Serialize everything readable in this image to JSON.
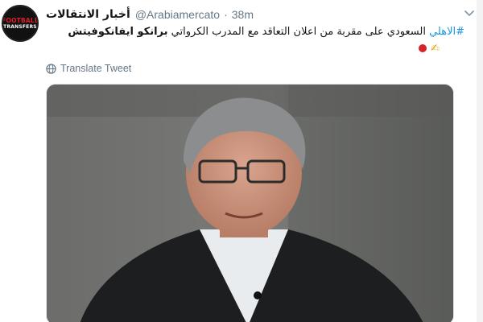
{
  "tweet": {
    "avatar": {
      "line1": "FOOTBALL",
      "line2": "TRANSFERS"
    },
    "display_name": "أخبار الانتقالات",
    "handle": "@Arabiamercato",
    "separator": "·",
    "time": "38m",
    "text": {
      "hashtag": "#الاهلي",
      "body": "السعودي على مقربة من اعلان التعاقد مع المدرب الكرواتي",
      "bold_name": "برانكو ايفانكوفيتش"
    },
    "translate_label": "Translate Tweet"
  },
  "colors": {
    "link": "#1b95e0",
    "muted": "#657786",
    "accent_red": "#d8232a"
  },
  "icons": [
    "chevron-down-icon",
    "globe-icon",
    "red-circle-emoji",
    "pen-emoji"
  ]
}
